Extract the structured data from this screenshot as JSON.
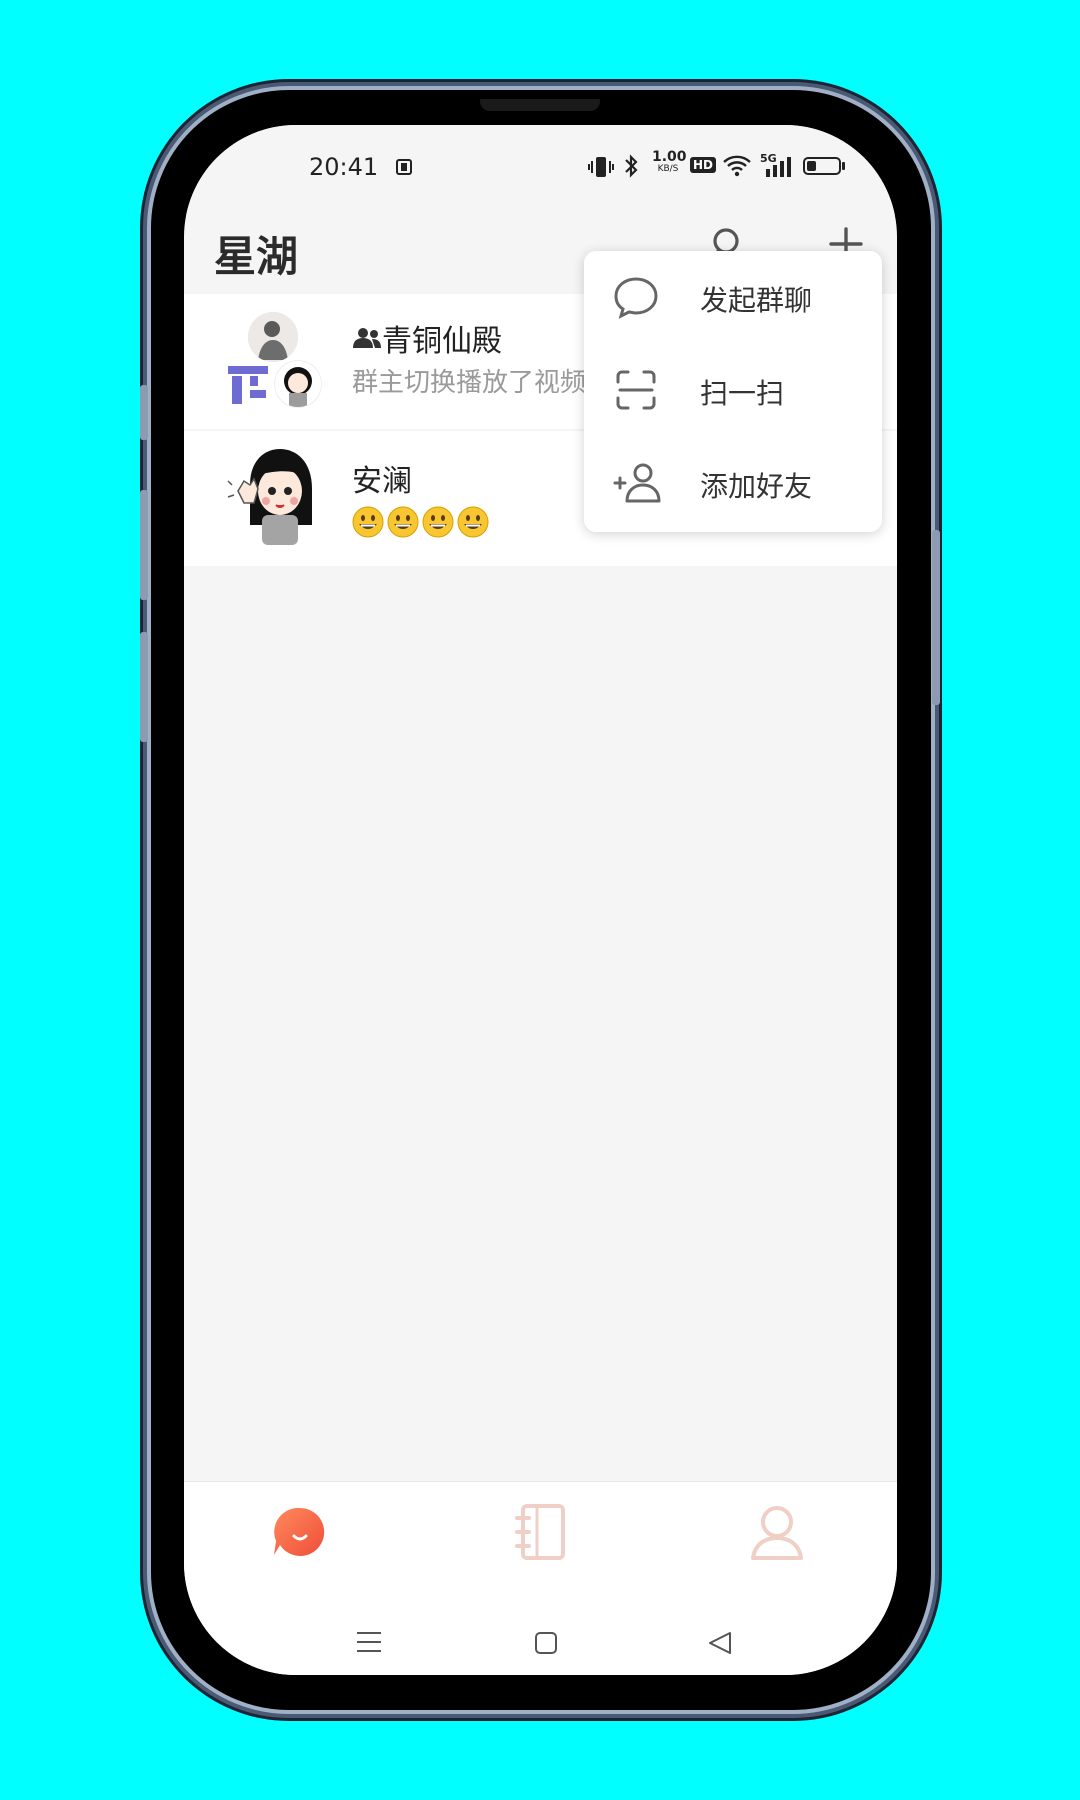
{
  "status_bar": {
    "time": "20:41",
    "net_speed_value": "1.00",
    "net_speed_unit": "KB/S",
    "hd_badge": "HD",
    "network": "5G",
    "battery_level": 0.3
  },
  "header": {
    "title": "星湖",
    "search_icon": "search-icon",
    "add_icon": "plus-icon"
  },
  "chats": [
    {
      "name": "青铜仙殿",
      "is_group": true,
      "preview": "群主切换播放了视频"
    },
    {
      "name": "安澜",
      "is_group": false,
      "preview_emojis": [
        "😀",
        "😀",
        "😀",
        "😀"
      ]
    }
  ],
  "popup_menu": {
    "items": [
      {
        "label": "发起群聊",
        "icon": "chat-bubble-icon"
      },
      {
        "label": "扫一扫",
        "icon": "scan-icon"
      },
      {
        "label": "添加好友",
        "icon": "add-user-icon"
      }
    ]
  },
  "tab_bar": {
    "tabs": [
      {
        "name": "messages",
        "icon": "message-bubble-icon",
        "active": true
      },
      {
        "name": "contacts",
        "icon": "notebook-icon",
        "active": false
      },
      {
        "name": "profile",
        "icon": "person-icon",
        "active": false
      }
    ]
  },
  "colors": {
    "accent": "#f4673f",
    "inactive_tab": "#f0cfc6",
    "background": "#f5f5f5",
    "device_background": "#00ffff"
  }
}
